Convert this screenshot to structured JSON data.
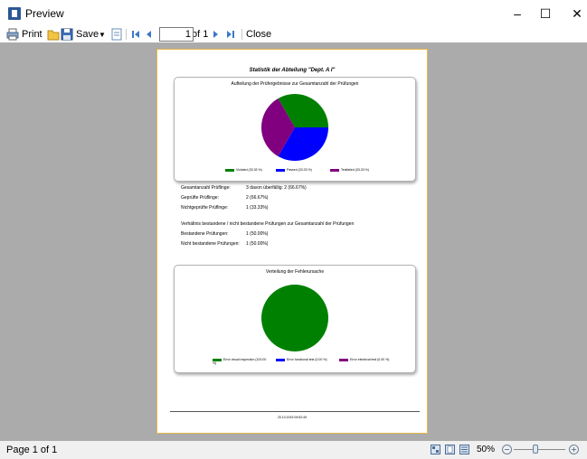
{
  "window": {
    "title": "Preview"
  },
  "toolbar": {
    "print_label": "Print",
    "save_label": "Save",
    "page_value": "1",
    "page_of": "of 1",
    "close_label": "Close"
  },
  "document": {
    "title": "Statistik der Abteilung \"Dept. A I\"",
    "chart1": {
      "title": "Aufteilung der Prüfergebnisse zur Gesamtanzahl der Prüfungen",
      "legend": [
        "Violated (33.33 %)",
        "Passed (33.33 %)",
        "Testfailed (33.33 %)"
      ]
    },
    "stats": [
      {
        "label": "Gesamtanzahl Prüflinge:",
        "value": "3 davon überfällig: 2 (66.67%)"
      },
      {
        "label": "Geprüfte Prüflinge:",
        "value": "2 (66.67%)"
      },
      {
        "label": "Nichtgeprüfte Prüflinge:",
        "value": "1 (33.33%)"
      }
    ],
    "ratio_heading": "Verhältnis bestandene / nicht bestandene Prüfungen zur Gesamtanzahl der Prüfungen",
    "ratio_stats": [
      {
        "label": "Bestandene Prüfungen:",
        "value": "1 (50.00%)"
      },
      {
        "label": "Nicht bestandene Prüfungen:",
        "value": "1 (50.00%)"
      }
    ],
    "chart2": {
      "title": "Verteilung der Fehlerursache",
      "legend": [
        "Error visual inspection (100.00 %)",
        "Error functional test (0.00 %)",
        "Error electrical test (0.00 %)"
      ]
    },
    "footer": "20.10.2015 09:52:49"
  },
  "chart_data": [
    {
      "type": "pie",
      "title": "Aufteilung der Prüfergebnisse zur Gesamtanzahl der Prüfungen",
      "categories": [
        "Violated",
        "Passed",
        "Testfailed"
      ],
      "values": [
        33.33,
        33.33,
        33.33
      ],
      "colors": [
        "#008000",
        "#0000ff",
        "#800080"
      ],
      "legend": "bottom"
    },
    {
      "type": "pie",
      "title": "Verteilung der Fehlerursache",
      "categories": [
        "Error visual inspection",
        "Error functional test",
        "Error electrical test"
      ],
      "values": [
        100.0,
        0.0,
        0.0
      ],
      "colors": [
        "#008000",
        "#0000ff",
        "#800080"
      ],
      "legend": "bottom"
    }
  ],
  "statusbar": {
    "page_label": "Page 1 of 1",
    "zoom": "50%"
  }
}
